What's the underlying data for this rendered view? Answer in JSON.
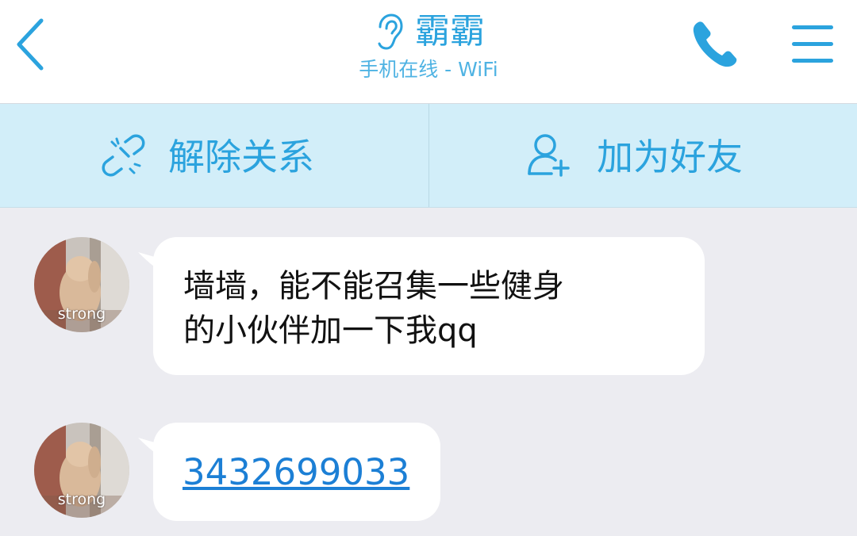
{
  "header": {
    "title": "霸霸",
    "subtitle": "手机在线 - WiFi",
    "accent_color": "#2ba3de",
    "icons": [
      "back-arrow-icon",
      "ear-icon",
      "phone-icon",
      "menu-icon"
    ]
  },
  "actions": [
    {
      "label": "解除关系",
      "icon": "broken-link-icon"
    },
    {
      "label": "加为好友",
      "icon": "add-user-icon"
    }
  ],
  "messages": [
    {
      "avatar_caption": "strong",
      "lines": [
        "墙墙，能不能召集一些健身",
        "的小伙伴加一下我qq"
      ]
    },
    {
      "avatar_caption": "strong",
      "link": "3432699033"
    }
  ]
}
